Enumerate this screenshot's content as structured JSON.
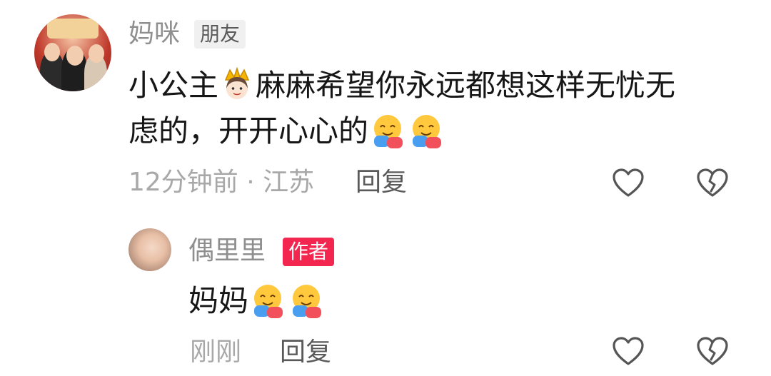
{
  "comment": {
    "username": "妈咪",
    "badge": "朋友",
    "text_before_crown": "小公主",
    "crown_icon": "princess-crown-emoji",
    "text_line1_rest": "麻麻希望你永远都想这样无忧无",
    "text_line2": "虑的，开开心心的",
    "hug_icons": [
      "hugging-face-emoji",
      "hugging-face-emoji"
    ],
    "time": "12分钟前",
    "separator": "·",
    "location": "江苏",
    "reply_label": "回复"
  },
  "reply": {
    "username": "偶里里",
    "badge": "作者",
    "text": "妈妈",
    "hug_icons": [
      "hugging-face-emoji",
      "hugging-face-emoji"
    ],
    "time": "刚刚",
    "reply_label": "回复"
  },
  "colors": {
    "author_badge": "#f2264e",
    "friend_badge_bg": "#f0f0f0",
    "username": "#8f8f8f",
    "meta": "#a8a8a8",
    "text": "#161616"
  }
}
